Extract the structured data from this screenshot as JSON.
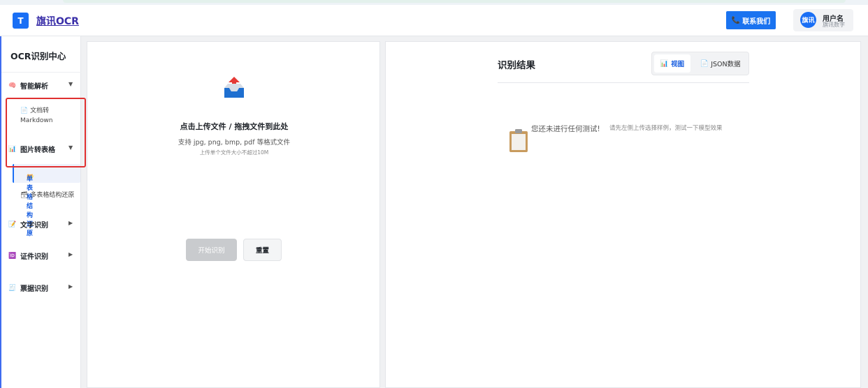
{
  "header": {
    "logo_letter": "T",
    "brand": "旗讯OCR",
    "contact_label": "联系我们",
    "avatar_text": "旗讯",
    "user_name": "用户名",
    "user_org": "旗讯数字"
  },
  "sidebar": {
    "title": "OCR识别中心",
    "groups": [
      {
        "label": "智能解析",
        "caret": "▼",
        "items": [
          {
            "line1": "文档转",
            "line2": "Markdown"
          }
        ]
      },
      {
        "label": "图片转表格",
        "caret": "▼",
        "items": [
          {
            "label": "单表格结构还原"
          },
          {
            "label": "多表格结构还原"
          }
        ]
      },
      {
        "label": "文字识别",
        "caret": "▶"
      },
      {
        "label": "证件识别",
        "caret": "▶"
      },
      {
        "label": "票据识别",
        "caret": "▶"
      }
    ]
  },
  "upload": {
    "title": "点击上传文件 / 拖拽文件到此处",
    "formats": "支持 jpg, png, bmp, pdf 等格式文件",
    "limit": "上传单个文件大小不超过10M",
    "start_label": "开始识别",
    "reset_label": "重置"
  },
  "result": {
    "title": "识别结果",
    "tab_view": "视图",
    "tab_json": "JSON数据",
    "empty_main": "您还未进行任何测试!",
    "empty_hint": "请先左侧上传选择样例，测试一下模型效果"
  },
  "colors": {
    "accent": "#1a6ff5",
    "highlight": "#e03030"
  }
}
